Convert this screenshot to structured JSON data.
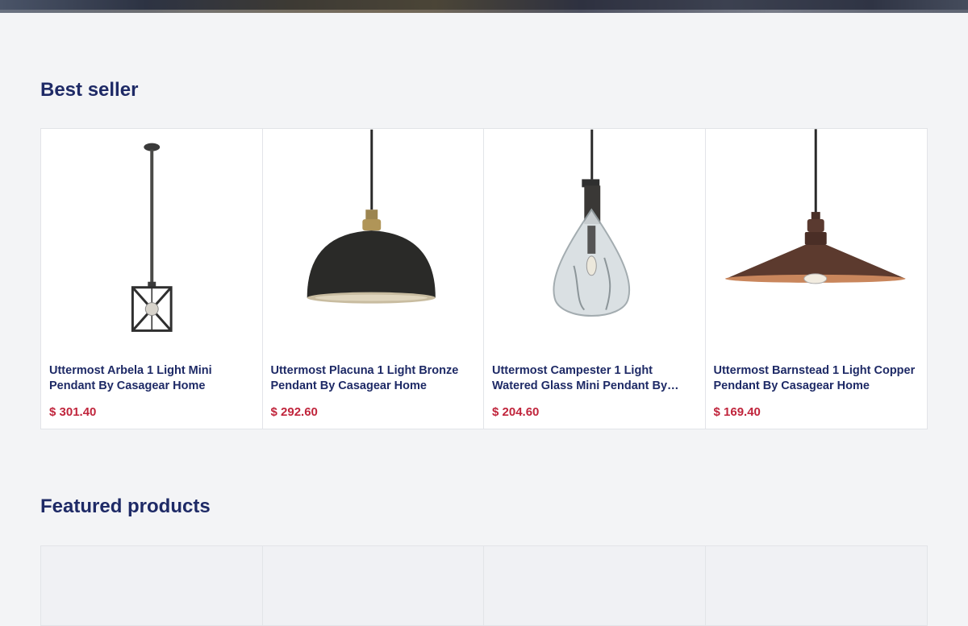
{
  "sections": {
    "best_seller": {
      "title": "Best seller",
      "products": [
        {
          "name": "Uttermost Arbela 1 Light Mini Pendant By Casagear Home",
          "price": "$ 301.40",
          "image": "cage-pendant-icon"
        },
        {
          "name": "Uttermost Placuna 1 Light Bronze Pendant By Casagear Home",
          "price": "$ 292.60",
          "image": "dome-pendant-icon"
        },
        {
          "name": "Uttermost Campester 1 Light Watered Glass Mini Pendant By Casagear Home",
          "price": "$ 204.60",
          "image": "glass-pendant-icon"
        },
        {
          "name": "Uttermost Barnstead 1 Light Copper Pendant By Casagear Home",
          "price": "$ 169.40",
          "image": "cone-pendant-icon"
        }
      ]
    },
    "featured": {
      "title": "Featured products"
    }
  },
  "colors": {
    "title": "#1e2a66",
    "price": "#c0253c",
    "background": "#f3f4f6"
  }
}
